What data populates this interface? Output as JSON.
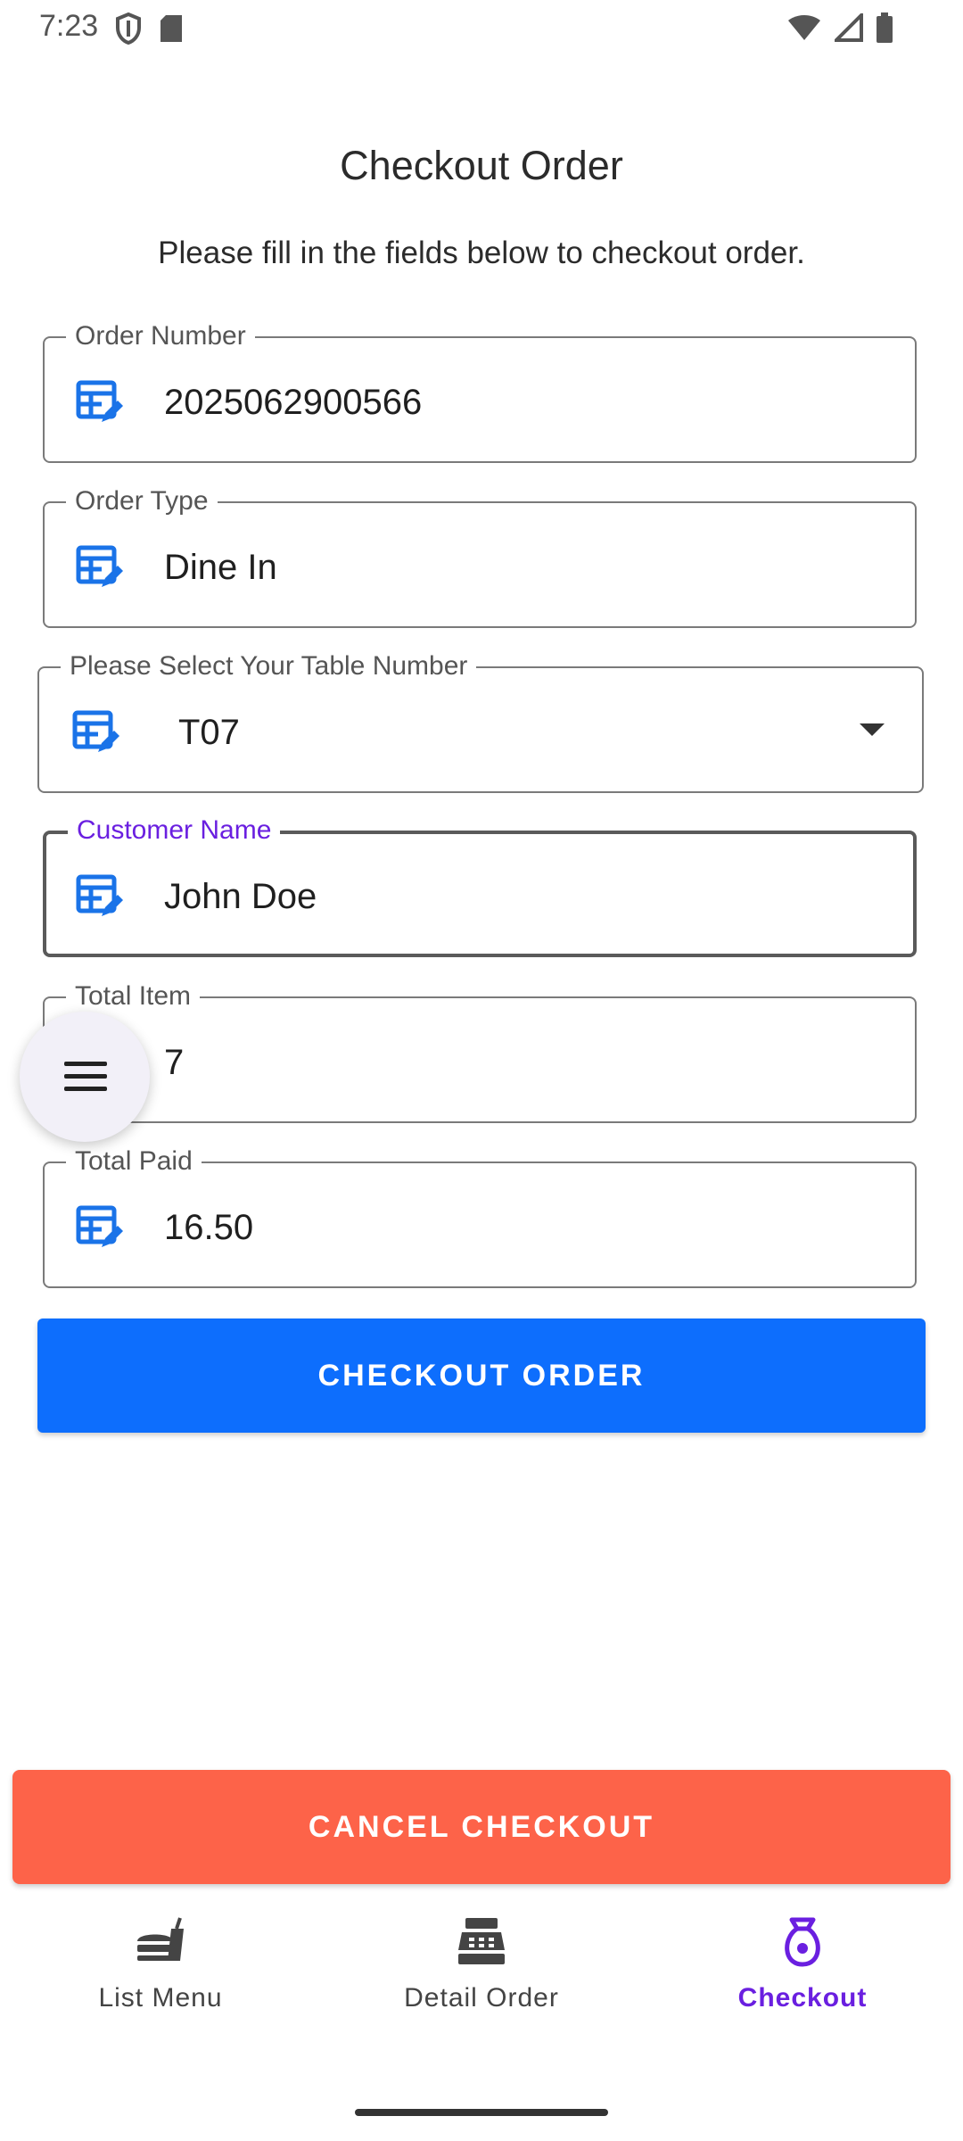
{
  "status_bar": {
    "time": "7:23"
  },
  "header": {
    "title": "Checkout Order",
    "subtitle": "Please fill in the fields below to checkout order."
  },
  "form": {
    "order_number": {
      "label": "Order Number",
      "value": "2025062900566"
    },
    "order_type": {
      "label": "Order Type",
      "value": "Dine In"
    },
    "table_number": {
      "label": "Please Select Your Table Number",
      "value": "T07"
    },
    "customer_name": {
      "label": "Customer Name",
      "value": "John Doe"
    },
    "total_item": {
      "label": "Total Item",
      "value": "7"
    },
    "total_paid": {
      "label": "Total Paid",
      "value": "16.50"
    }
  },
  "buttons": {
    "checkout_label": "CHECKOUT ORDER",
    "cancel_label": "CANCEL CHECKOUT"
  },
  "bottom_nav": {
    "items": [
      {
        "label": "List Menu",
        "icon": "fastfood-icon",
        "active": false
      },
      {
        "label": "Detail Order",
        "icon": "cash-register-icon",
        "active": false
      },
      {
        "label": "Checkout",
        "icon": "money-bag-icon",
        "active": true
      }
    ]
  },
  "colors": {
    "primary": "#0d6efd",
    "cancel": "#fd6349",
    "accent": "#6a1fe0",
    "field_icon": "#1a73e8"
  }
}
